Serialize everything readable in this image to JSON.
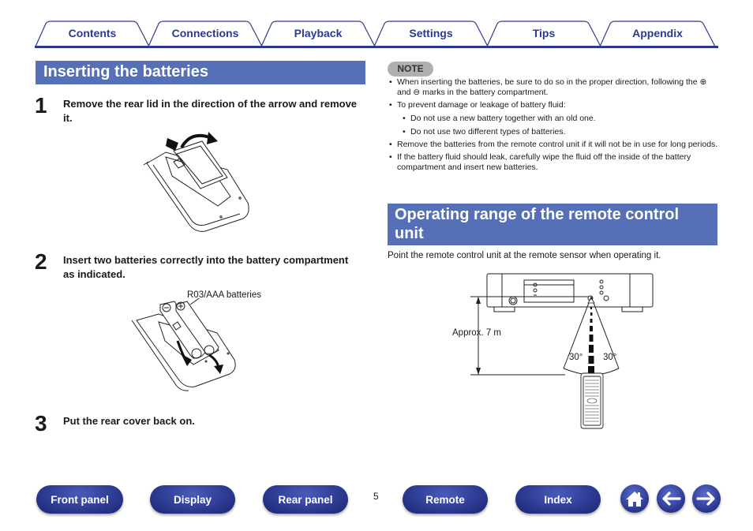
{
  "tabs": [
    {
      "label": "Contents"
    },
    {
      "label": "Connections"
    },
    {
      "label": "Playback"
    },
    {
      "label": "Settings"
    },
    {
      "label": "Tips"
    },
    {
      "label": "Appendix"
    }
  ],
  "left_section": {
    "title": "Inserting the batteries",
    "steps": [
      {
        "number": "1",
        "text": "Remove the rear lid in the direction of the arrow and remove it."
      },
      {
        "number": "2",
        "text": "Insert two batteries correctly into the battery compartment as indicated."
      },
      {
        "number": "3",
        "text": "Put the rear cover back on."
      }
    ],
    "battery_label": "R03/AAA batteries"
  },
  "note": {
    "badge": "NOTE",
    "items": [
      {
        "text": "When inserting the batteries, be sure to do so in the proper direction, following the ⊕ and ⊖ marks in the battery compartment."
      },
      {
        "text": "To prevent damage or leakage of battery fluid:"
      },
      {
        "text": "Do not use a new battery together with an old one."
      },
      {
        "text": "Do not use two different types of batteries."
      },
      {
        "text": "Remove the batteries from the remote control unit if it will not be in use for long periods."
      },
      {
        "text": "If the battery fluid should leak, carefully wipe the fluid off the inside of the battery compartment and insert new batteries."
      }
    ]
  },
  "right_section": {
    "title": "Operating range of the remote control unit",
    "body": "Point the remote control unit at the remote sensor when operating it.",
    "diagram": {
      "distance_label": "Approx. 7 m",
      "angle_left": "30°",
      "angle_right": "30°"
    }
  },
  "footer": {
    "buttons": [
      {
        "label": "Front panel"
      },
      {
        "label": "Display"
      },
      {
        "label": "Rear panel"
      },
      {
        "label": "Remote"
      },
      {
        "label": "Index"
      }
    ],
    "page_number": "5",
    "icons": [
      "home-icon",
      "back-arrow-icon",
      "forward-arrow-icon"
    ]
  },
  "colors": {
    "brand_blue": "#2b3990",
    "heading_blue": "#5670b7",
    "note_gray": "#b0b0b0"
  }
}
